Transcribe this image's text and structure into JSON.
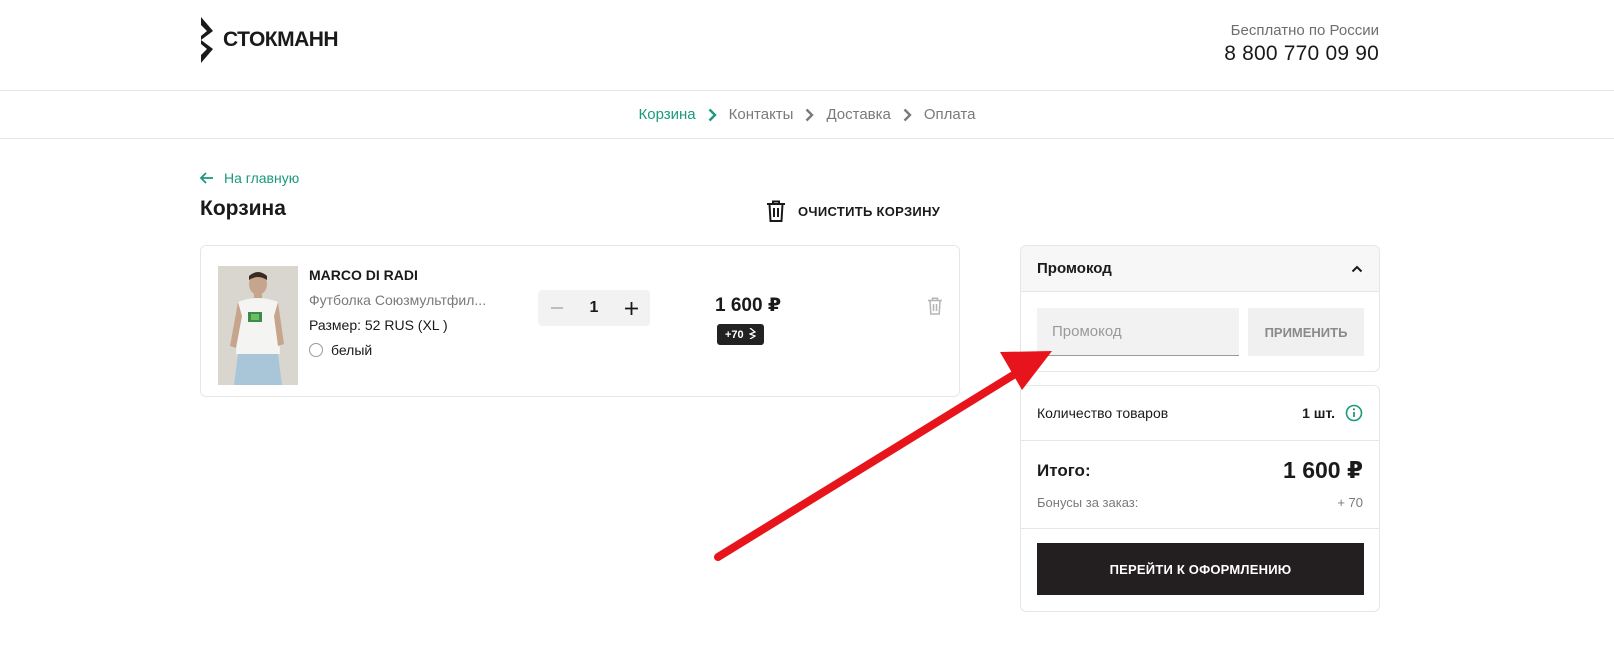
{
  "header": {
    "logo_text": "СТОКМАНН",
    "phone_caption": "Бесплатно по России",
    "phone_number": "8 800 770 09 90"
  },
  "steps": [
    {
      "label": "Корзина",
      "active": true
    },
    {
      "label": "Контакты",
      "active": false
    },
    {
      "label": "Доставка",
      "active": false
    },
    {
      "label": "Оплата",
      "active": false
    }
  ],
  "page": {
    "back_link": "На главную",
    "title": "Корзина",
    "clear_cart": "ОЧИСТИТЬ КОРЗИНУ"
  },
  "cart_item": {
    "brand": "MARCO DI RADI",
    "name": "Футболка Союзмультфил...",
    "size": "Размер: 52 RUS (XL )",
    "color": "белый",
    "quantity": "1",
    "price": "1 600 ₽",
    "bonus": "+70"
  },
  "promo": {
    "title": "Промокод",
    "placeholder": "Промокод",
    "apply_label": "ПРИМЕНИТЬ"
  },
  "summary": {
    "count_label": "Количество товаров",
    "count_value": "1 шт.",
    "total_label": "Итого:",
    "total_value": "1 600 ₽",
    "bonus_label": "Бонусы за заказ:",
    "bonus_value": "+ 70",
    "checkout_label": "ПЕРЕЙТИ К ОФОРМЛЕНИЮ"
  },
  "colors": {
    "accent": "#1a9a7b",
    "dark": "#231f20",
    "annotation": "#e8141b"
  },
  "icons": {
    "back": "arrow-left-icon",
    "step_separator": "chevron-right-icon",
    "clear": "trash-icon",
    "collapse": "chevron-up-icon",
    "info": "info-icon"
  }
}
